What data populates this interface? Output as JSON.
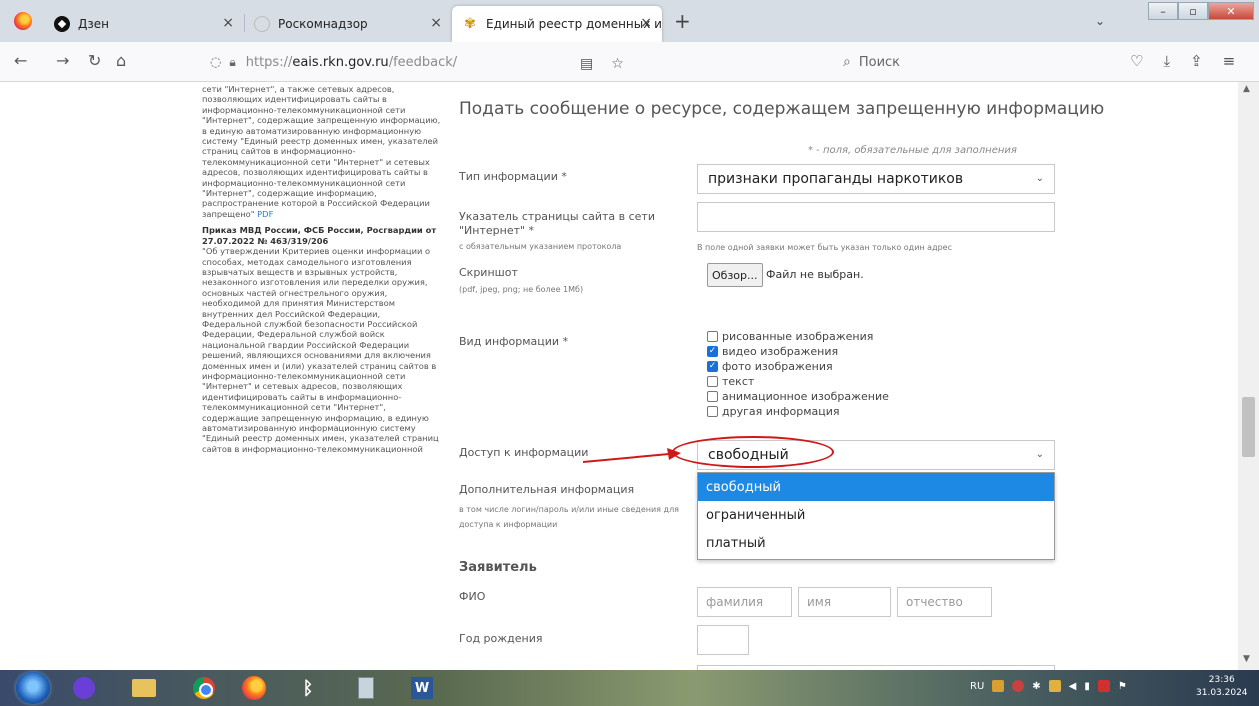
{
  "browser": {
    "tabs": [
      {
        "label": "Дзен",
        "icon": "dzen-icon"
      },
      {
        "label": "Роскомнадзор",
        "icon": "rkn-icon"
      },
      {
        "label": "Единый реестр доменных им…",
        "icon": "eais-icon",
        "active": true
      }
    ],
    "url_prefix": "https://",
    "url_domain": "eais.rkn.gov.ru",
    "url_path": "/feedback/",
    "search_placeholder": "Поиск"
  },
  "left_column": {
    "para1": "сети \"Интернет\", а также сетевых адресов, позволяющих идентифицировать сайты в информационно-телекоммуникационной сети \"Интернет\", содержащие запрещенную информацию, в единую автоматизированную информационную систему \"Единый реестр доменных имен, указателей страниц сайтов в информационно-телекоммуникационной сети \"Интернет\" и сетевых адресов, позволяющих идентифицировать сайты в информационно-телекоммуникационной сети \"Интернет\", содержащие информацию, распространение которой в Российской Федерации запрещено\"",
    "para1_pdf": "PDF",
    "doc2_title": "Приказ МВД России, ФСБ России, Росгвардии от 27.07.2022 № 463/319/206",
    "doc2_text": "\"Об утверждении Критериев оценки информации о способах, методах самодельного изготовления взрывчатых веществ и взрывных устройств, незаконного изготовления или переделки оружия, основных частей огнестрельного оружия, необходимой для принятия Министерством внутренних дел Российской Федерации, Федеральной службой безопасности Российской Федерации, Федеральной службой войск национальной гвардии Российской Федерации решений, являющихся основаниями для включения доменных имен и (или) указателей страниц сайтов в информационно-телекоммуникационной сети \"Интернет\" и сетевых адресов, позволяющих идентифицировать сайты в информационно-телекоммуникационной сети \"Интернет\", содержащие запрещенную информацию, в единую автоматизированную информационную систему \"Единый реестр доменных имен, указателей страниц сайтов в информационно-телекоммуникационной"
  },
  "form": {
    "title": "Подать сообщение о ресурсе, содержащем запрещенную информацию",
    "required_note": "* - поля, обязательные для заполнения",
    "info_type_label": "Тип информации *",
    "info_type_value": "признаки пропаганды наркотиков",
    "url_label": "Указатель страницы сайта в сети \"Интернет\" *",
    "url_sublabel": "с обязательным указанием протокола",
    "url_hint": "В поле одной заявки может быть указан только один адрес",
    "screenshot_label": "Скриншот",
    "screenshot_sublabel": "(pdf, jpeg, png; не более 1Мб)",
    "browse_button": "Обзор...",
    "no_file": "Файл не выбран.",
    "info_kind_label": "Вид информации *",
    "info_kind_options": [
      {
        "label": "рисованные изображения",
        "checked": false
      },
      {
        "label": "видео изображения",
        "checked": true
      },
      {
        "label": "фото изображения",
        "checked": true
      },
      {
        "label": "текст",
        "checked": false
      },
      {
        "label": "анимационное изображение",
        "checked": false
      },
      {
        "label": "другая информация",
        "checked": false
      }
    ],
    "access_label": "Доступ к информации",
    "access_value": "свободный",
    "access_options": [
      "свободный",
      "ограниченный",
      "платный"
    ],
    "extra_label": "Дополнительная информация",
    "extra_sublabel": "в том числе логин/пароль и/или иные сведения для доступа к информации",
    "applicant_heading": "Заявитель",
    "fio_label": "ФИО",
    "fio_placeholders": {
      "surname": "фамилия",
      "name": "имя",
      "patronymic": "отчество"
    },
    "birth_year_label": "Год рождения"
  },
  "taskbar": {
    "lang": "RU",
    "time": "23:36",
    "date": "31.03.2024"
  },
  "colors": {
    "dropdown_selected": "#1e88e5",
    "annotation_red": "#d01818",
    "checkbox_checked": "#1a6fd8"
  }
}
